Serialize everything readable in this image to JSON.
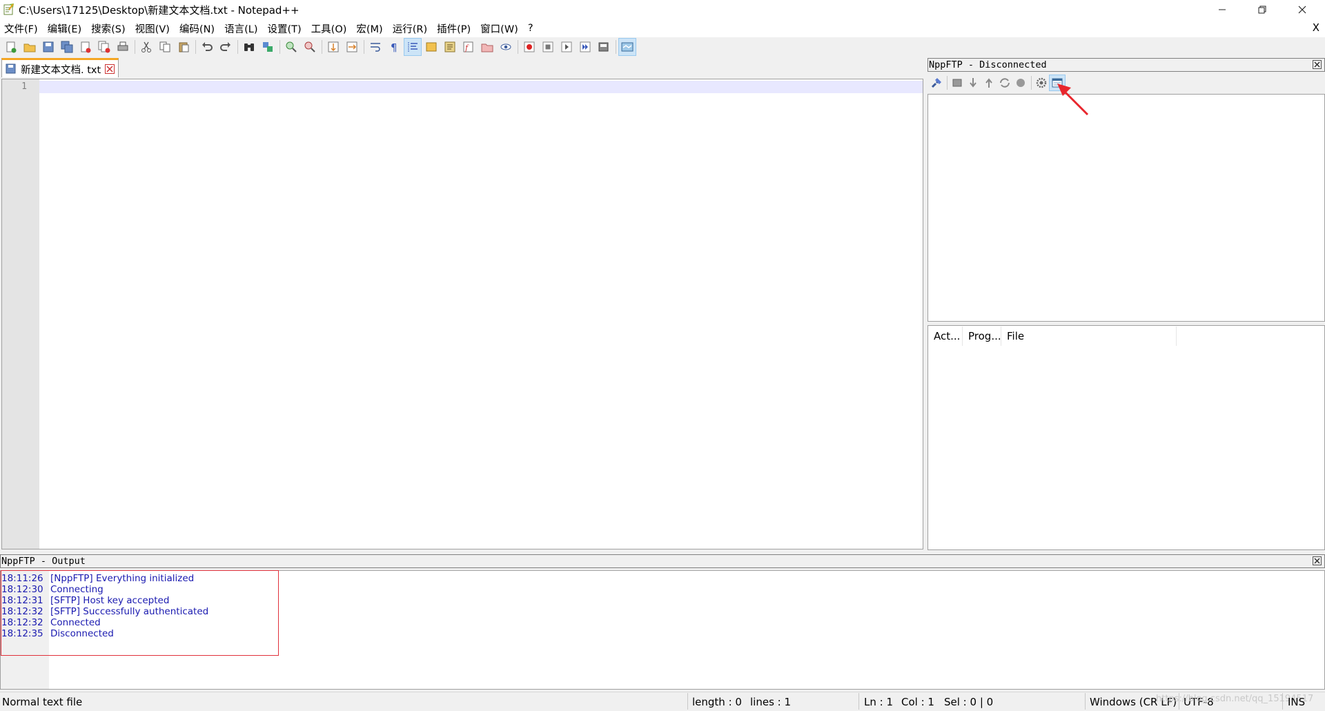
{
  "window": {
    "title": "C:\\Users\\17125\\Desktop\\新建文本文档.txt - Notepad++",
    "minimize_icon": "minimize-icon",
    "maximize_icon": "restore-icon",
    "close_icon": "close-icon"
  },
  "menu": {
    "items": [
      "文件(F)",
      "编辑(E)",
      "搜索(S)",
      "视图(V)",
      "编码(N)",
      "语言(L)",
      "设置(T)",
      "工具(O)",
      "宏(M)",
      "运行(R)",
      "插件(P)",
      "窗口(W)",
      "?"
    ],
    "close_label": "X"
  },
  "tab": {
    "label": "新建文本文档. txt"
  },
  "editor": {
    "line_number": "1",
    "current_line_color": "#e8e8ff"
  },
  "ftp": {
    "caption": "NppFTP - Disconnected",
    "toolbar_icons": [
      "connect-icon",
      "disconnect-icon",
      "download-icon",
      "upload-icon",
      "refresh-icon",
      "abort-icon",
      "settings-icon",
      "message-window-icon"
    ],
    "queue_columns": [
      "Act...",
      "Prog...",
      "File"
    ]
  },
  "output": {
    "caption": "NppFTP - Output",
    "lines": [
      {
        "time": "18:11:26",
        "text": "[NppFTP] Everything initialized"
      },
      {
        "time": "18:12:30",
        "text": "Connecting"
      },
      {
        "time": "18:12:31",
        "text": "[SFTP] Host key accepted"
      },
      {
        "time": "18:12:32",
        "text": "[SFTP] Successfully authenticated"
      },
      {
        "time": "18:12:32",
        "text": "Connected"
      },
      {
        "time": "18:12:35",
        "text": "Disconnected"
      }
    ],
    "text_color": "#1a1ab0",
    "highlight_color": "#e0303a"
  },
  "status": {
    "file_type": "Normal text file",
    "length": "length : 0",
    "lines": "lines : 1",
    "ln": "Ln : 1",
    "col": "Col : 1",
    "sel": "Sel : 0 | 0",
    "eol": "Windows (CR LF)",
    "encoding": "UTF-8",
    "mode": "INS",
    "watermark": "https://blog.csdn.net/qq_15194517"
  },
  "colors": {
    "tab_accent": "#f5a623",
    "arrow": "#e8262d"
  }
}
